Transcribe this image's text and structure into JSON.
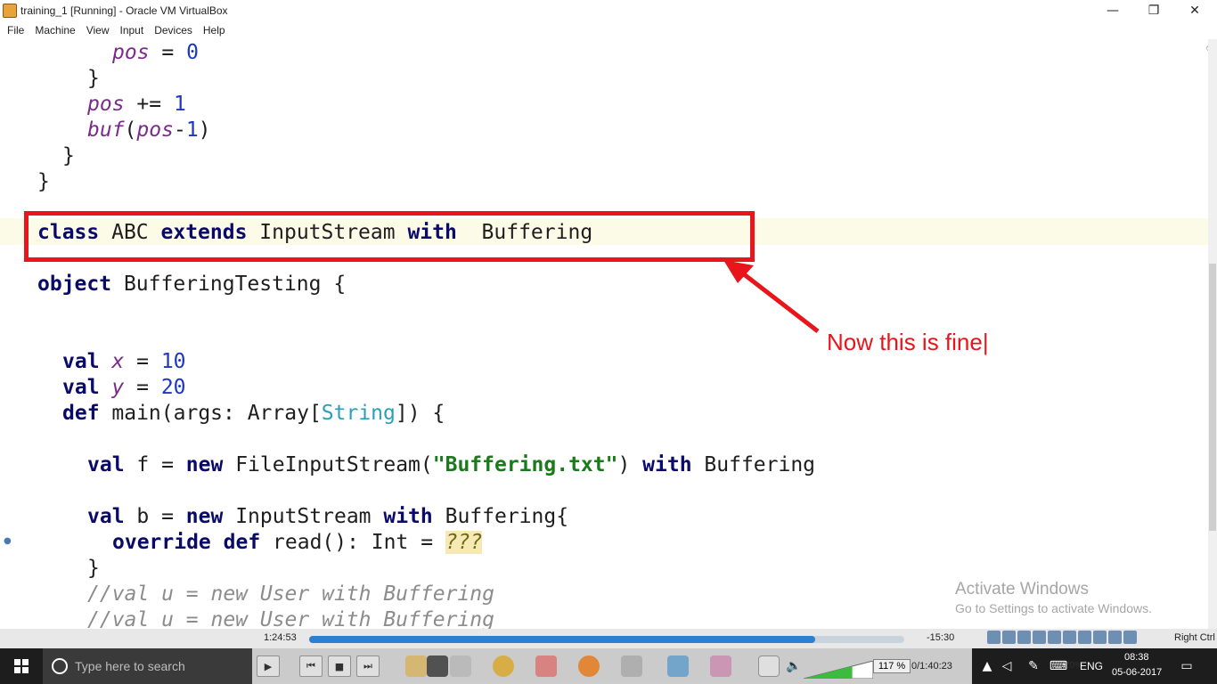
{
  "window": {
    "title": "training_1 [Running] - Oracle VM VirtualBox",
    "minimize": "—",
    "maximize": "❐",
    "close": "✕"
  },
  "menu": [
    "File",
    "Machine",
    "View",
    "Input",
    "Devices",
    "Help"
  ],
  "code": {
    "l1_ident": "pos",
    "l1_op": " = ",
    "l1_num": "0",
    "l2": "}",
    "l3_ident": "pos",
    "l3_op": " += ",
    "l3_num": "1",
    "l4_fn": "buf",
    "l4_p1": "(",
    "l4_ident": "pos",
    "l4_op": "-",
    "l4_num": "1",
    "l4_p2": ")",
    "l5": "}",
    "l6": "}",
    "l7_kw1": "class",
    "l7_t1": " ABC ",
    "l7_kw2": "extends",
    "l7_t2": " InputStream ",
    "l7_kw3": "with",
    "l7_t3": "  Buffering",
    "l8_kw": "object",
    "l8_t": " BufferingTesting {",
    "l9_kw": "val",
    "l9_id": "x",
    "l9_op": " = ",
    "l9_num": "10",
    "l10_kw": "val",
    "l10_id": "y",
    "l10_op": " = ",
    "l10_num": "20",
    "l11_kw": "def",
    "l11_t1": " main(args: Array[",
    "l11_type": "String",
    "l11_t2": "]) {",
    "l12_kw1": "val",
    "l12_t1": " f = ",
    "l12_kw2": "new",
    "l12_t2": " FileInputStream(",
    "l12_str": "\"Buffering.txt\"",
    "l12_t3": ") ",
    "l12_kw3": "with",
    "l12_t4": " Buffering",
    "l13_kw1": "val",
    "l13_t1": " b = ",
    "l13_kw2": "new",
    "l13_t2": " InputStream ",
    "l13_kw3": "with",
    "l13_t3": " Buffering{",
    "l14_kw1": "override",
    "l14_sp": " ",
    "l14_kw2": "def",
    "l14_t1": " read(): Int = ",
    "l14_todo": "???",
    "l15": "}",
    "l16": "//val u = new User with Buffering",
    "l17": "//val u = new User with Buffering"
  },
  "annotation": {
    "note": "Now this is fine|"
  },
  "activate": {
    "title": "Activate Windows",
    "subtitle": "Go to Settings to activate Windows."
  },
  "player": {
    "elapsed": "1:24:53",
    "remaining": "-15:30",
    "progress": 0.85,
    "zoom": "117 %",
    "volume": "70%",
    "duration": "0/1:40:23",
    "host_key": "Right Ctrl"
  },
  "taskbar": {
    "search_placeholder": "Type here to search",
    "language": "ENG",
    "time": "08:38",
    "date": "05-06-2017"
  }
}
